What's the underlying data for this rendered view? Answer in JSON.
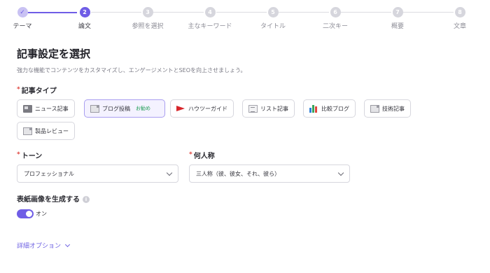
{
  "stepper": {
    "steps": [
      {
        "num": "✓",
        "label": "テーマ",
        "state": "done"
      },
      {
        "num": "2",
        "label": "論文",
        "state": "active"
      },
      {
        "num": "3",
        "label": "参照を選択",
        "state": "todo"
      },
      {
        "num": "4",
        "label": "主なキーワード",
        "state": "todo"
      },
      {
        "num": "5",
        "label": "タイトル",
        "state": "todo"
      },
      {
        "num": "6",
        "label": "二次キー",
        "state": "todo"
      },
      {
        "num": "7",
        "label": "概要",
        "state": "todo"
      },
      {
        "num": "8",
        "label": "文章",
        "state": "todo"
      }
    ]
  },
  "page": {
    "title": "記事設定を選択",
    "subtitle": "強力な機能でコンテンツをカスタマイズし、エンゲージメントとSEOを向上させましょう。"
  },
  "article_type": {
    "label": "記事タイプ",
    "required_mark": "*",
    "options": [
      {
        "label": "ニュース記事",
        "icon": "newspaper-icon",
        "selected": false,
        "badge": ""
      },
      {
        "label": "ブログ投稿",
        "icon": "document-icon",
        "selected": true,
        "badge": "お勧め"
      },
      {
        "label": "ハウツーガイド",
        "icon": "red-flag-icon",
        "selected": false,
        "badge": ""
      },
      {
        "label": "リスト記事",
        "icon": "list-icon",
        "selected": false,
        "badge": ""
      },
      {
        "label": "比較ブログ",
        "icon": "bar-chart-icon",
        "selected": false,
        "badge": ""
      },
      {
        "label": "技術記事",
        "icon": "document-icon",
        "selected": false,
        "badge": ""
      },
      {
        "label": "製品レビュー",
        "icon": "document-icon",
        "selected": false,
        "badge": ""
      }
    ]
  },
  "tone": {
    "label": "トーン",
    "required_mark": "*",
    "value": "プロフェッショナル"
  },
  "person": {
    "label": "何人称",
    "required_mark": "*",
    "value": "三人称（彼、彼女、それ、彼ら）"
  },
  "cover_image": {
    "label": "表紙画像を生成する",
    "info_glyph": "i",
    "toggle_label": "オン",
    "enabled": true
  },
  "advanced": {
    "label": "詳細オプション"
  },
  "colors": {
    "accent": "#6f5de6",
    "required": "#e0463f",
    "badge_green": "#1f9d55"
  }
}
